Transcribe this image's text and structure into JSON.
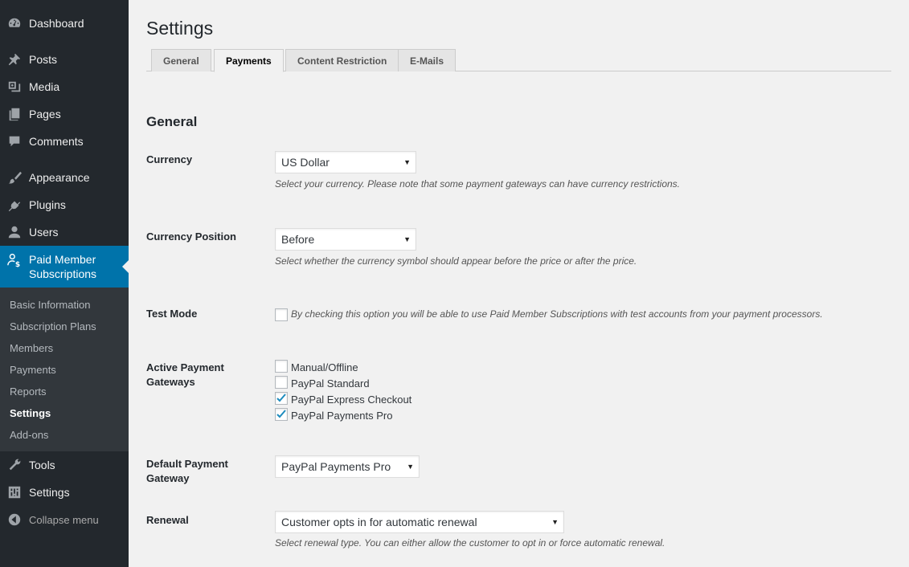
{
  "sidebar": {
    "menu": [
      {
        "label": "Dashboard",
        "icon": "dashboard-icon"
      },
      {
        "label": "Posts",
        "icon": "pin-icon"
      },
      {
        "label": "Media",
        "icon": "media-icon"
      },
      {
        "label": "Pages",
        "icon": "pages-icon"
      },
      {
        "label": "Comments",
        "icon": "comment-icon"
      },
      {
        "label": "Appearance",
        "icon": "brush-icon"
      },
      {
        "label": "Plugins",
        "icon": "plugin-icon"
      },
      {
        "label": "Users",
        "icon": "user-icon"
      }
    ],
    "active_label": "Paid Member Subscriptions",
    "active_label_line1": "Paid Member",
    "active_label_line2": "Subscriptions",
    "submenu": [
      {
        "label": "Basic Information"
      },
      {
        "label": "Subscription Plans"
      },
      {
        "label": "Members"
      },
      {
        "label": "Payments"
      },
      {
        "label": "Reports"
      },
      {
        "label": "Settings",
        "current": true
      },
      {
        "label": "Add-ons"
      }
    ],
    "menu_after": [
      {
        "label": "Tools",
        "icon": "wrench-icon"
      },
      {
        "label": "Settings",
        "icon": "settings-icon"
      }
    ],
    "collapse_label": "Collapse menu",
    "accent_color": "#0073aa"
  },
  "page": {
    "title": "Settings",
    "tabs": [
      {
        "label": "General"
      },
      {
        "label": "Payments",
        "active": true
      },
      {
        "label": "Content Restriction"
      },
      {
        "label": "E-Mails"
      }
    ],
    "section_heading": "General"
  },
  "fields": {
    "currency": {
      "label": "Currency",
      "value": "US Dollar",
      "description": "Select your currency. Please note that some payment gateways can have currency restrictions."
    },
    "currency_position": {
      "label": "Currency Position",
      "value": "Before",
      "description": "Select whether the currency symbol should appear before the price or after the price."
    },
    "test_mode": {
      "label": "Test Mode",
      "checked": false,
      "description": "By checking this option you will be able to use Paid Member Subscriptions with test accounts from your payment processors."
    },
    "gateways": {
      "label_line1": "Active Payment",
      "label_line2": "Gateways",
      "options": [
        {
          "label": "Manual/Offline",
          "checked": false
        },
        {
          "label": "PayPal Standard",
          "checked": false
        },
        {
          "label": "PayPal Express Checkout",
          "checked": true
        },
        {
          "label": "PayPal Payments Pro",
          "checked": true
        }
      ]
    },
    "default_gateway": {
      "label_line1": "Default Payment",
      "label_line2": "Gateway",
      "value": "PayPal Payments Pro"
    },
    "renewal": {
      "label": "Renewal",
      "value": "Customer opts in for automatic renewal",
      "description": "Select renewal type. You can either allow the customer to opt in or force automatic renewal."
    }
  }
}
